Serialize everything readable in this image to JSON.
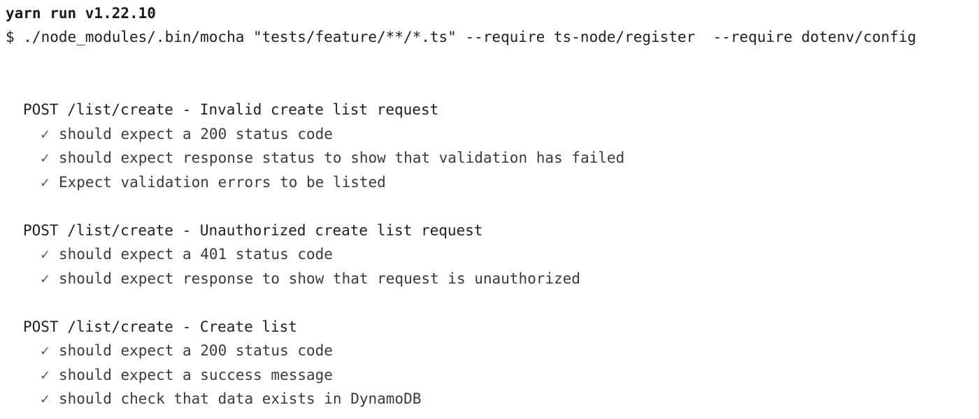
{
  "header": {
    "title": "yarn run v1.22.10",
    "command": "$ ./node_modules/.bin/mocha \"tests/feature/**/*.ts\" --require ts-node/register  --require dotenv/config"
  },
  "check_glyph": "✓",
  "suites": [
    {
      "title": "POST /list/create - Invalid create list request",
      "tests": [
        "should expect a 200 status code",
        "should expect response status to show that validation has failed",
        "Expect validation errors to be listed"
      ]
    },
    {
      "title": "POST /list/create - Unauthorized create list request",
      "tests": [
        "should expect a 401 status code",
        "should expect response to show that request is unauthorized"
      ]
    },
    {
      "title": "POST /list/create - Create list",
      "tests": [
        "should expect a 200 status code",
        "should expect a success message",
        "should check that data exists in DynamoDB"
      ]
    }
  ]
}
